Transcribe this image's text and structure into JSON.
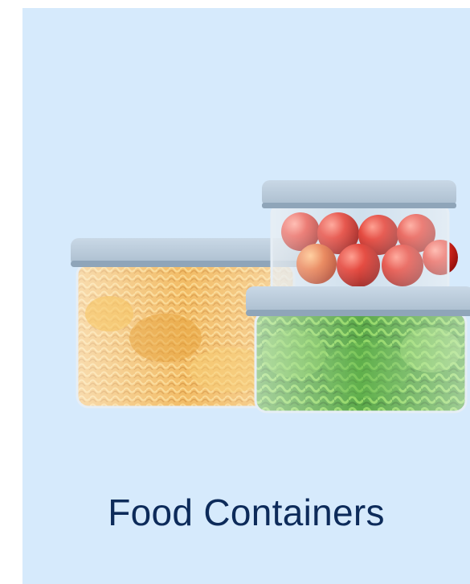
{
  "category_tile": {
    "label": "Food Containers",
    "background_color": "#d6eafc",
    "label_color": "#0d2b5a"
  }
}
